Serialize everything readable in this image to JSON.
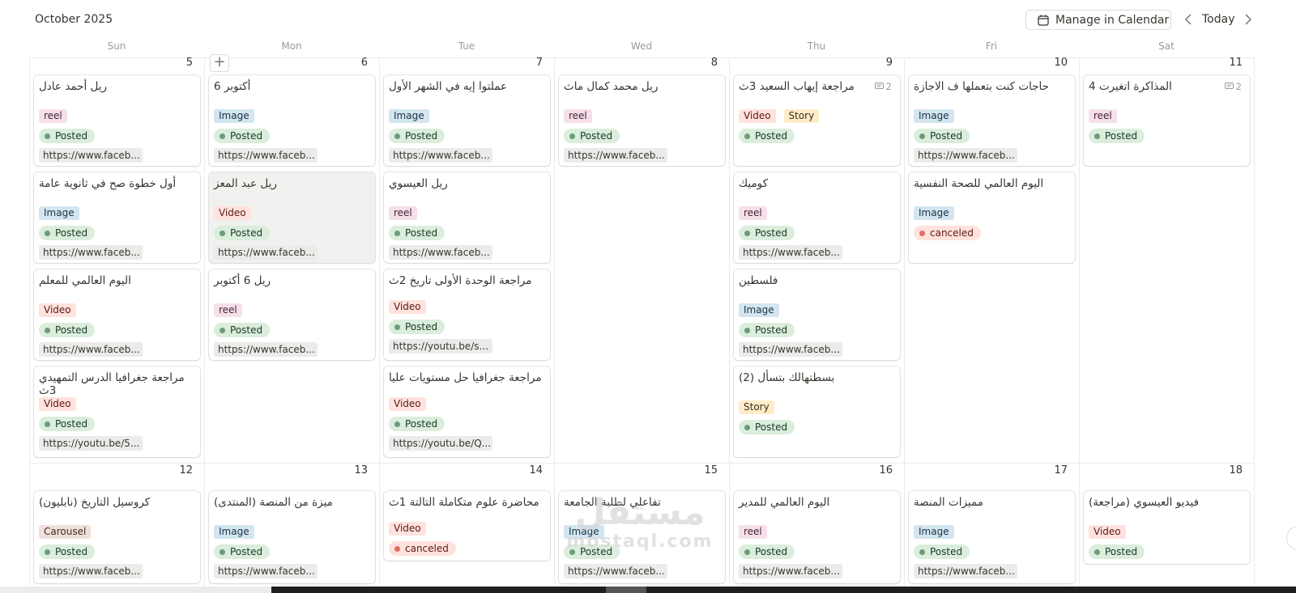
{
  "header": {
    "month": "October 2025",
    "manage_label": "Manage in Calendar",
    "today_label": "Today"
  },
  "weekdays": [
    "Sun",
    "Mon",
    "Tue",
    "Wed",
    "Thu",
    "Fri",
    "Sat"
  ],
  "weeks": [
    {
      "days": [
        {
          "num": "5",
          "cards": [
            {
              "title": "ريل أحمد عادل",
              "tags": [
                "reel"
              ],
              "status": "Posted",
              "url": "https://www.faceb..."
            },
            {
              "title": "أول خطوة صح في ثانوية عامة",
              "tags": [
                "Image"
              ],
              "status": "Posted",
              "url": "https://www.faceb..."
            },
            {
              "title": "اليوم العالمي للمعلم",
              "tags": [
                "Video"
              ],
              "status": "Posted",
              "url": "https://www.faceb..."
            },
            {
              "title": "مراجعة جغرافيا الدرس التمهيدي 3ث",
              "tags": [
                "Video"
              ],
              "status": "Posted",
              "url": "https://youtu.be/5..."
            }
          ]
        },
        {
          "num": "6",
          "cards": [
            {
              "title": "أكتوبر 6",
              "tags": [
                "Image"
              ],
              "status": "Posted",
              "url": "https://www.faceb..."
            },
            {
              "title": "ريل عبد المعز",
              "tags": [
                "Video"
              ],
              "status": "Posted",
              "url": "https://www.faceb...",
              "highlight": true
            },
            {
              "title": "ريل 6 أكتوبر",
              "tags": [
                "reel"
              ],
              "status": "Posted",
              "url": "https://www.faceb..."
            }
          ]
        },
        {
          "num": "7",
          "cards": [
            {
              "title": "عملتوا إيه في الشهر الأول",
              "tags": [
                "Image"
              ],
              "status": "Posted",
              "url": "https://www.faceb..."
            },
            {
              "title": "ريل العيسوي",
              "tags": [
                "reel"
              ],
              "status": "Posted",
              "url": "https://www.faceb..."
            },
            {
              "title": "مراجعة الوحدة الأولى تاريخ 2ث",
              "tags": [
                "Video"
              ],
              "status": "Posted",
              "url": "https://youtu.be/s..."
            },
            {
              "title": "مراجعة جغرافيا حل مستويات عليا",
              "tags": [
                "Video"
              ],
              "status": "Posted",
              "url": "https://youtu.be/Q..."
            }
          ]
        },
        {
          "num": "8",
          "cards": [
            {
              "title": "ريل محمد كمال ماث",
              "tags": [
                "reel"
              ],
              "status": "Posted",
              "url": "https://www.faceb..."
            }
          ]
        },
        {
          "num": "9",
          "cards": [
            {
              "title": "مراجعة إيهاب السعيد 3ث",
              "tags": [
                "Video",
                "Story"
              ],
              "status": "Posted",
              "comments": "2"
            },
            {
              "title": "كوميك",
              "tags": [
                "reel"
              ],
              "status": "Posted",
              "url": "https://www.faceb..."
            },
            {
              "title": "فلسطين",
              "tags": [
                "Image"
              ],
              "status": "Posted",
              "url": "https://www.faceb..."
            },
            {
              "title": "بسطتهالك بتسأل (2)",
              "tags": [
                "Story"
              ],
              "status": "Posted"
            }
          ]
        },
        {
          "num": "10",
          "cards": [
            {
              "title": "حاجات كنت بتعملها ف الاجازة",
              "tags": [
                "Image"
              ],
              "status": "Posted",
              "url": "https://www.faceb..."
            },
            {
              "title": "اليوم العالمي للصحة النفسية",
              "tags": [
                "Image"
              ],
              "status": "canceled"
            }
          ]
        },
        {
          "num": "11",
          "cards": [
            {
              "title": "المذاكرة اتغيرت 4",
              "tags": [
                "reel"
              ],
              "status": "Posted",
              "comments": "2"
            }
          ]
        }
      ]
    },
    {
      "days": [
        {
          "num": "12",
          "cards": [
            {
              "title": "كروسيل التاريخ (نابليون)",
              "tags": [
                "Carousel"
              ],
              "status": "Posted",
              "url": "https://www.faceb..."
            }
          ]
        },
        {
          "num": "13",
          "cards": [
            {
              "title": "ميزة من المنصة (المنتدى)",
              "tags": [
                "Image"
              ],
              "status": "Posted",
              "url": "https://www.faceb..."
            }
          ]
        },
        {
          "num": "14",
          "cards": [
            {
              "title": "محاضرة علوم متكاملة التالتة 1ث",
              "tags": [
                "Video"
              ],
              "status": "canceled"
            }
          ]
        },
        {
          "num": "15",
          "cards": [
            {
              "title": "تفاعلي لطلبة الجامعة",
              "tags": [
                "Image"
              ],
              "status": "Posted",
              "url": "https://www.faceb..."
            }
          ]
        },
        {
          "num": "16",
          "cards": [
            {
              "title": "اليوم العالمي للمدير",
              "tags": [
                "reel"
              ],
              "status": "Posted",
              "url": "https://www.faceb..."
            }
          ]
        },
        {
          "num": "17",
          "cards": [
            {
              "title": "مميزات المنصة",
              "tags": [
                "Image"
              ],
              "status": "Posted",
              "url": "https://www.faceb..."
            }
          ]
        },
        {
          "num": "18",
          "cards": [
            {
              "title": "فيديو العيسوي (مراجعة)",
              "tags": [
                "Video"
              ],
              "status": "Posted"
            }
          ]
        }
      ]
    }
  ],
  "tag_colors": {
    "reel": {
      "bg": "#f5e0e9",
      "fg": "#4c2337"
    },
    "Image": {
      "bg": "#d3e5ef",
      "fg": "#183347"
    },
    "Video": {
      "bg": "#ffe2dd",
      "fg": "#5d1715"
    },
    "Story": {
      "bg": "#fdecc8",
      "fg": "#402c1b"
    },
    "Carousel": {
      "bg": "#eee0da",
      "fg": "#442a1e"
    }
  },
  "status_colors": {
    "Posted": {
      "bg": "#dbeddb",
      "fg": "#1c3829",
      "dot": "#6c9b7d"
    },
    "canceled": {
      "bg": "#ffe2dd",
      "fg": "#5d1715",
      "dot": "#e16f64"
    }
  },
  "watermark": {
    "arabic": "مستقل",
    "latin": "mostaql.com"
  }
}
